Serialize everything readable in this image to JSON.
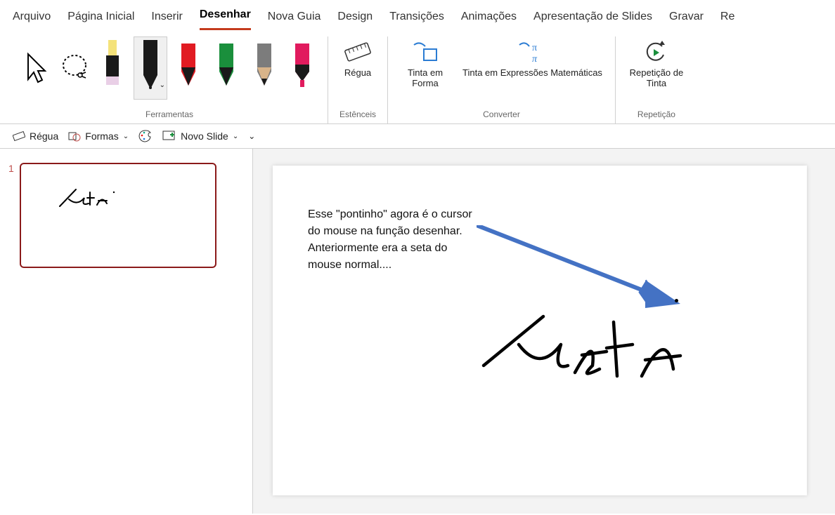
{
  "tabs": {
    "arquivo": "Arquivo",
    "pagina_inicial": "Página Inicial",
    "inserir": "Inserir",
    "desenhar": "Desenhar",
    "nova_guia": "Nova Guia",
    "design": "Design",
    "transicoes": "Transições",
    "animacoes": "Animações",
    "apresentacao": "Apresentação de Slides",
    "gravar": "Gravar",
    "revisao": "Re"
  },
  "ribbon": {
    "group_ferramentas": "Ferramentas",
    "group_estenceis": "Estênceis",
    "group_converter": "Converter",
    "group_repeticao": "Repetição",
    "regua": "Régua",
    "tinta_forma": "Tinta em Forma",
    "tinta_expr": "Tinta em Expressões Matemáticas",
    "repeticao_tinta": "Repetição de Tinta",
    "pen_colors": {
      "highlighter": "#f4e27a",
      "black": "#1a1a1a",
      "red": "#e11b22",
      "green": "#1a8f3c",
      "gray": "#7c7c7c",
      "pink": "#e11b5e"
    }
  },
  "qat": {
    "regua": "Régua",
    "formas": "Formas",
    "novo_slide": "Novo Slide"
  },
  "thumbnail": {
    "number": "1",
    "ink_text": "Teste"
  },
  "slide": {
    "note_text": "Esse \"pontinho\" agora é o cursor do mouse na função desenhar. Anteriormente era a seta do mouse normal....",
    "ink_text": "Teste",
    "arrow_color": "#4472c4"
  }
}
